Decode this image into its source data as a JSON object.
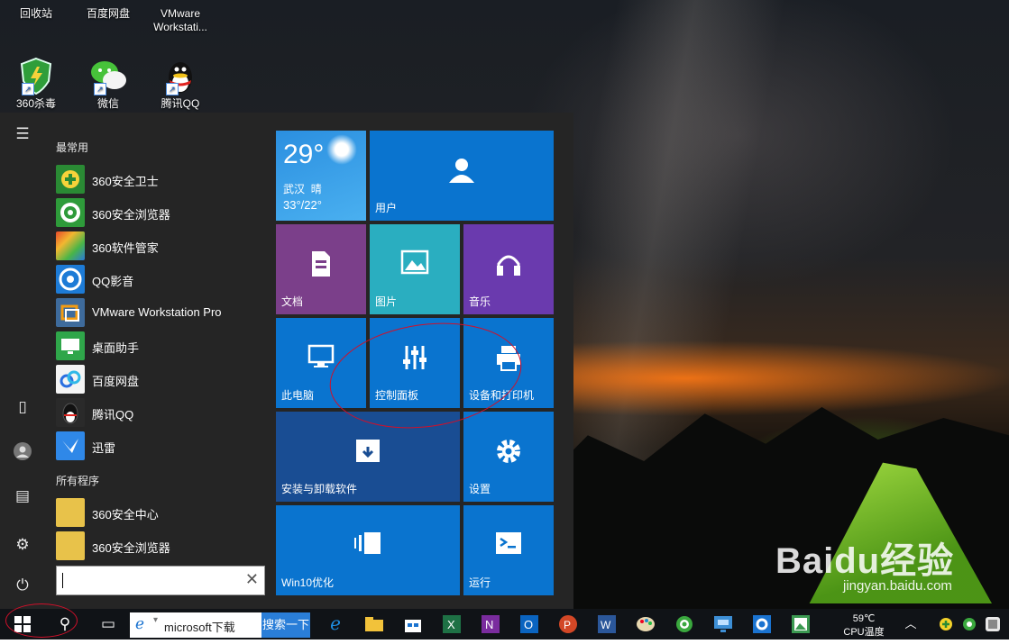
{
  "desktop": {
    "icons": [
      {
        "label": "回收站"
      },
      {
        "label": "百度网盘"
      },
      {
        "label": "VMware Workstati..."
      },
      {
        "label": "360杀毒"
      },
      {
        "label": "微信"
      },
      {
        "label": "腾讯QQ"
      }
    ],
    "watermark": {
      "brand": "Baidu经验",
      "url": "jingyan.baidu.com"
    }
  },
  "start_menu": {
    "most_used_label": "最常用",
    "all_programs_label": "所有程序",
    "most_used": [
      {
        "label": "360安全卫士",
        "color": "#2a8a34"
      },
      {
        "label": "360安全浏览器",
        "color": "#2e9b3a"
      },
      {
        "label": "360软件管家",
        "color": "#d8422a"
      },
      {
        "label": "QQ影音",
        "color": "#1d7bd6"
      },
      {
        "label": "VMware Workstation Pro",
        "color": "#3e6b9c"
      },
      {
        "label": "桌面助手",
        "color": "#2fa64a"
      },
      {
        "label": "百度网盘",
        "color": "#2a6fe0"
      },
      {
        "label": "腾讯QQ",
        "color": "#1a1a1a"
      },
      {
        "label": "迅雷",
        "color": "#2f88e8"
      }
    ],
    "all_programs": [
      {
        "label": "360安全中心",
        "color": "#e8c24a"
      },
      {
        "label": "360安全浏览器",
        "color": "#e8c24a"
      }
    ],
    "search": {
      "value": ""
    },
    "tiles": {
      "weather": {
        "temp": "29°",
        "city": "武汉",
        "cond": "晴",
        "range": "33°/22°"
      },
      "user": "用户",
      "documents": "文档",
      "pictures": "图片",
      "music": "音乐",
      "this_pc": "此电脑",
      "control_panel": "控制面板",
      "devices_printers": "设备和打印机",
      "install_uninstall": "安装与卸载软件",
      "settings": "设置",
      "win10_opt": "Win10优化",
      "run": "运行"
    }
  },
  "taskbar": {
    "search_value": "microsoft下载",
    "search_button": "搜索一下",
    "cpu_temp": "59℃",
    "cpu_label": "CPU温度"
  },
  "colors": {
    "tile_blue": "#0a74cf",
    "tile_purple": "#7b3f8a",
    "tile_teal": "#2aaec0",
    "tile_violet": "#6a3aae",
    "tile_navy": "#194d93",
    "annotation": "#d0102a"
  }
}
